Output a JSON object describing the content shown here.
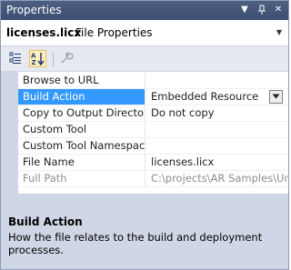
{
  "window": {
    "title": "Properties",
    "dropdown_glyph": "▼",
    "pin_glyph": "ᵖ",
    "close_glyph": "✕"
  },
  "object_selector": {
    "name": "licenses.licx",
    "type": "File Properties",
    "dropdown_glyph": "▼"
  },
  "toolbar": {
    "buttons": [
      {
        "icon": "categorized-icon",
        "active": false
      },
      {
        "icon": "alphabetical-icon",
        "active": true
      },
      {
        "icon": "property-pages-wrench-icon",
        "active": false
      }
    ]
  },
  "properties": [
    {
      "name": "Browse to URL",
      "value": ""
    },
    {
      "name": "Build Action",
      "value": "Embedded Resource",
      "selected": true,
      "has_dropdown": true
    },
    {
      "name": "Copy to Output Directory",
      "value": "Do not copy"
    },
    {
      "name": "Custom Tool",
      "value": ""
    },
    {
      "name": "Custom Tool Namespace",
      "value": ""
    },
    {
      "name": "File Name",
      "value": "licenses.licx"
    },
    {
      "name": "Full Path",
      "value": "C:\\projects\\AR Samples\\Un",
      "readonly": true
    }
  ],
  "description": {
    "title": "Build Action",
    "text": "How the file relates to the build and deployment processes."
  },
  "colors": {
    "titlebar": "#3c4f71",
    "selection": "#3399ff",
    "panel_background": "#cfd6e5"
  }
}
